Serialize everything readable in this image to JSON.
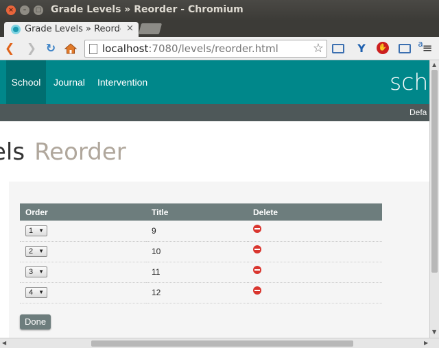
{
  "window": {
    "title": "Grade Levels » Reorder - Chromium"
  },
  "tab": {
    "title": "Grade Levels » Reorde",
    "close": "×"
  },
  "toolbar": {
    "url_host": "localhost",
    "url_rest": ":7080/levels/reorder.html",
    "ext_a": "a"
  },
  "nav": {
    "items": [
      "School",
      "Journal",
      "Intervention"
    ],
    "brand": "sch"
  },
  "subbar": {
    "text": "Defa"
  },
  "heading": {
    "main": "els",
    "sub": "Reorder"
  },
  "table": {
    "headers": [
      "Order",
      "Title",
      "Delete"
    ],
    "rows": [
      {
        "order": "1",
        "title": "9"
      },
      {
        "order": "2",
        "title": "10"
      },
      {
        "order": "3",
        "title": "11"
      },
      {
        "order": "4",
        "title": "12"
      }
    ]
  },
  "done_label": "Done",
  "colors": {
    "nav": "#00878a",
    "nav_active": "#006e70",
    "subbar": "#4e5859",
    "table_header": "#6d7d7d",
    "delete": "#d9352e"
  }
}
